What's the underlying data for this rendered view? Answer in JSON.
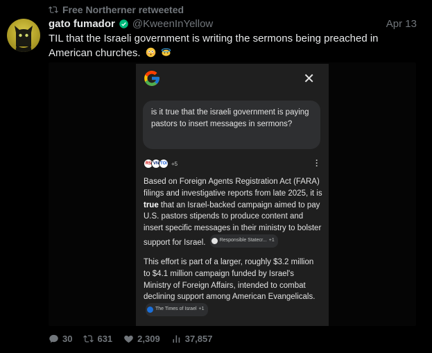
{
  "retweet": {
    "label": "Free Northerner retweeted"
  },
  "author": {
    "name": "gato fumador",
    "handle": "@KweenInYellow"
  },
  "date": "Apr 13",
  "tweet": {
    "text": "TIL that the Israeli government is writing the sermons being preached in American churches."
  },
  "screenshot": {
    "query": "is it true that the israeli government is paying pastors to insert messages in sermons?",
    "source_icons": [
      "RS",
      "VN",
      "TOI"
    ],
    "more_sources": "+5",
    "answer_part1_a": "Based on Foreign Agents Registration Act (FARA) filings and investigative reports from late 2025, it is ",
    "answer_part1_bold": "true",
    "answer_part1_b": " that an Israel-backed campaign aimed to pay U.S. pastors stipends to produce content and insert specific messages in their ministry to bolster support for Israel.",
    "chip1_label": "Responsible Statecr...",
    "chip1_more": "+1",
    "answer_part2": "This effort is part of a larger, roughly $3.2 million to $4.1 million campaign funded by Israel's Ministry of Foreign Affairs, intended to combat declining support among American Evangelicals.",
    "chip2_label": "The Times of Israel",
    "chip2_more": "+1"
  },
  "stats": {
    "replies": "30",
    "retweets": "631",
    "likes": "2,309",
    "views": "37,857"
  },
  "colors": {
    "background": "#000000",
    "muted": "#71767b",
    "verified": "#00ba7c"
  }
}
